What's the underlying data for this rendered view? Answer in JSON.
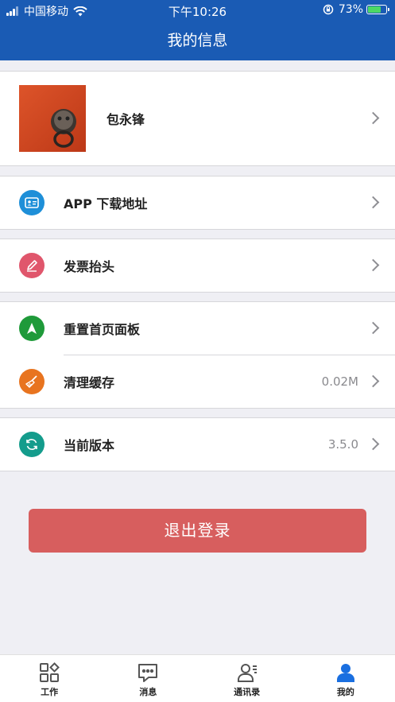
{
  "status": {
    "carrier": "中国移动",
    "time": "下午10:26",
    "battery_pct": "73%",
    "battery_level": 0.73
  },
  "header": {
    "title": "我的信息"
  },
  "profile": {
    "name": "包永锋"
  },
  "menu": {
    "download": {
      "label": "APP 下载地址",
      "icon": "id-card-icon",
      "color": "#1e8fd8"
    },
    "invoice": {
      "label": "发票抬头",
      "icon": "pencil-icon",
      "color": "#e0566c"
    },
    "reset": {
      "label": "重置首页面板",
      "icon": "navigation-arrow-icon",
      "color": "#1f9a3a"
    },
    "cache": {
      "label": "清理缓存",
      "value": "0.02M",
      "icon": "broom-icon",
      "color": "#e8741f"
    },
    "version": {
      "label": "当前版本",
      "value": "3.5.0",
      "icon": "refresh-icon",
      "color": "#149c8c"
    }
  },
  "logout_label": "退出登录",
  "tabs": [
    {
      "label": "工作",
      "icon": "grid-apps-icon"
    },
    {
      "label": "消息",
      "icon": "chat-bubble-icon"
    },
    {
      "label": "通讯录",
      "icon": "contacts-icon"
    },
    {
      "label": "我的",
      "icon": "person-icon",
      "active": true
    }
  ],
  "colors": {
    "primary": "#1a5bb4",
    "logout": "#d75e5e",
    "active_tab": "#1a6fe0"
  }
}
